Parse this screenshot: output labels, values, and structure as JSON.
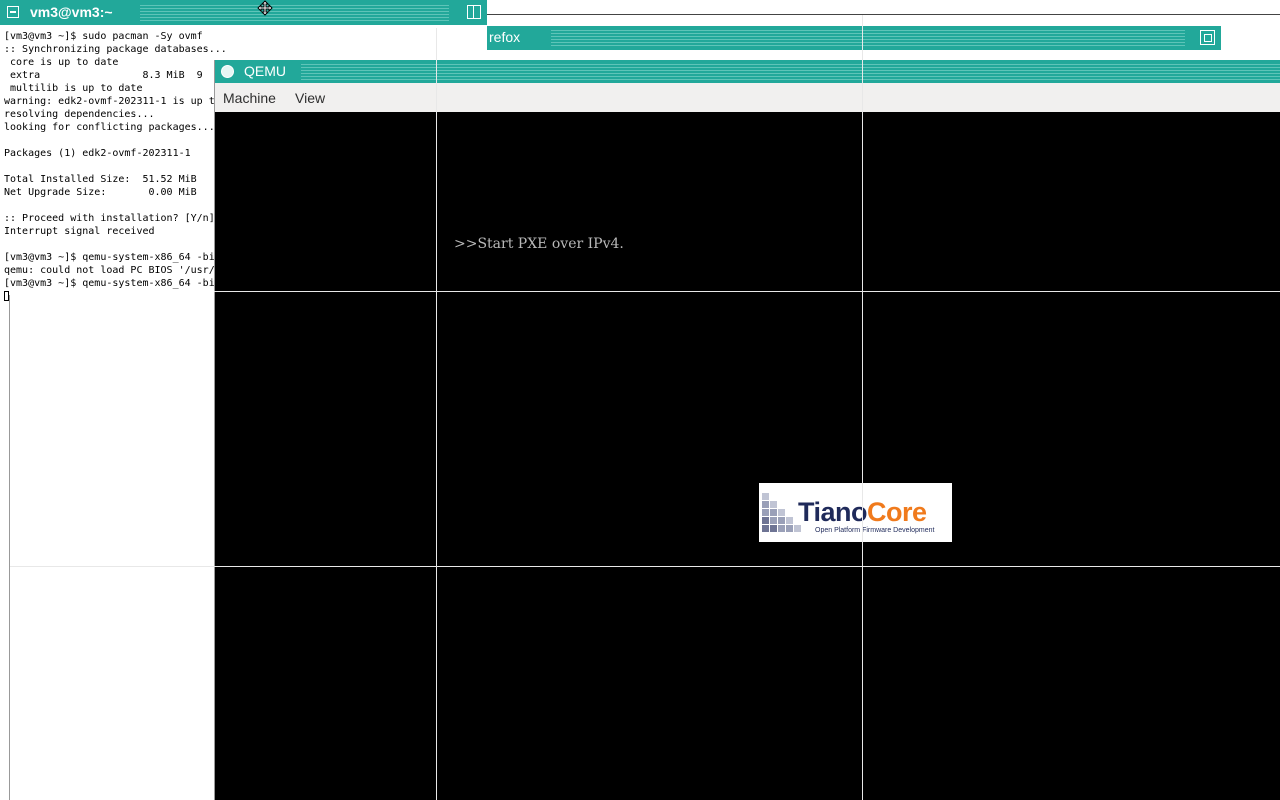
{
  "terminal": {
    "title": "vm3@vm3:~",
    "lines": [
      "[vm3@vm3 ~]$ sudo pacman -Sy ovmf",
      ":: Synchronizing package databases...",
      " core is up to date",
      " extra                 8.3 MiB  9",
      " multilib is up to date",
      "warning: edk2-ovmf-202311-1 is up t",
      "resolving dependencies...",
      "looking for conflicting packages...",
      "",
      "Packages (1) edk2-ovmf-202311-1",
      "",
      "Total Installed Size:  51.52 MiB",
      "Net Upgrade Size:       0.00 MiB",
      "",
      ":: Proceed with installation? [Y/n]",
      "Interrupt signal received",
      "",
      "[vm3@vm3 ~]$ qemu-system-x86_64 -bi",
      "qemu: could not load PC BIOS '/usr/",
      "[vm3@vm3 ~]$ qemu-system-x86_64 -bi"
    ]
  },
  "firefox": {
    "title": "refox"
  },
  "qemu": {
    "title": "QEMU",
    "menu": [
      "Machine",
      "View"
    ],
    "screen_text": ">>Start PXE over IPv4.",
    "logo": {
      "word_part1": "Tiano",
      "word_part2": "Core",
      "tagline": "Open Platform Firmware Development"
    }
  },
  "colors": {
    "titlebar": "#22a89a",
    "logo_blue": "#1f2a5a",
    "logo_orange": "#f07a1c"
  },
  "icons": [
    "window-menu-icon",
    "maximize-icon",
    "qemu-app-icon",
    "move-cursor-icon"
  ]
}
